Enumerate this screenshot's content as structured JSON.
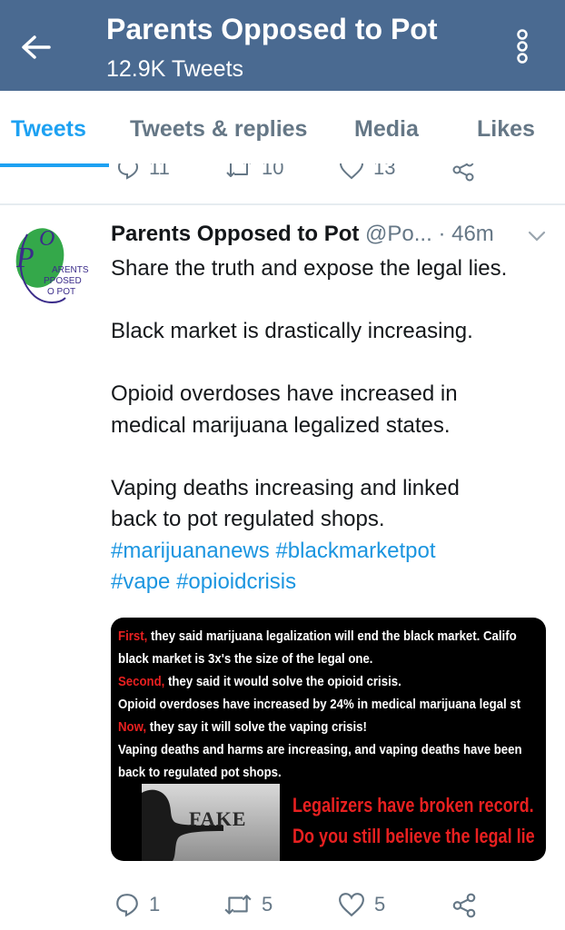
{
  "header": {
    "title": "Parents Opposed to Pot",
    "tweet_count": "12.9K Tweets",
    "background_color": "#4a6a91"
  },
  "tabs": [
    {
      "label": "Tweets",
      "active": true
    },
    {
      "label": "Tweets & replies",
      "active": false
    },
    {
      "label": "Media",
      "active": false
    },
    {
      "label": "Likes",
      "active": false
    }
  ],
  "previous_tweet_actions": {
    "replies": "11",
    "retweets": "10",
    "likes": "13"
  },
  "tweet": {
    "name": "Parents Opposed to Pot",
    "handle": "@Po...",
    "time": "· 46m",
    "avatar_logo_text": [
      "ARENTS",
      "PPOSED",
      "O POT"
    ],
    "text": {
      "line1": "Share the truth and expose the legal lies.",
      "line2": "Black market is drastically increasing.",
      "line3a": "Opioid overdoses have increased in",
      "line3b": "medical marijuana legalized states.",
      "line4a": "Vaping deaths increasing and linked",
      "line4b": "back to pot regulated shops."
    },
    "hashtags": {
      "h1": "#marijuananews",
      "h2": "#blackmarketpot",
      "h3": "#vape",
      "h4": "#opioidcrisis"
    },
    "image": {
      "r1_red": "First,",
      "r1": " they said marijuana legalization will end the black market. Califo",
      "r2": "black market is 3x's the size of the legal one.",
      "r3_red": "Second,",
      "r3": " they said it would solve the opioid crisis.",
      "r4": "Opioid overdoses have increased by 24% in medical marijuana legal st",
      "r5_red": "Now,",
      "r5": " they say it will solve the vaping crisis!",
      "r6": "Vaping deaths and harms are increasing, and vaping deaths have been",
      "r7": "back to regulated pot shops.",
      "fake_label": "FAKE",
      "slogan1": "Legalizers have broken record.",
      "slogan2": "Do you still believe the legal lie"
    },
    "actions": {
      "replies": "1",
      "retweets": "5",
      "likes": "5"
    }
  },
  "colors": {
    "accent": "#1da1f2",
    "hashtag": "#1b95e0",
    "muted": "#657786",
    "image_red": "#e82020"
  }
}
